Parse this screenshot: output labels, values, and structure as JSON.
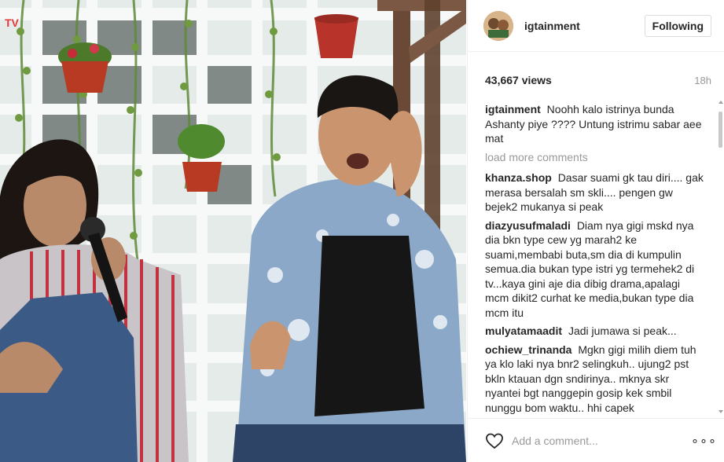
{
  "post": {
    "username": "igtainment",
    "follow_label": "Following",
    "views": "43,667 views",
    "time": "18h"
  },
  "caption": {
    "user": "igtainment",
    "text": "Noohh kalo istrinya bunda Ashanty piye ???? Untung istrimu sabar aee mat"
  },
  "load_more": "load more comments",
  "comments": [
    {
      "user": "khanza.shop",
      "text": "Dasar suami gk tau diri.... gak merasa bersalah sm skli.... pengen gw bejek2 mukanya si peak"
    },
    {
      "user": "diazyusufmaladi",
      "text": "Diam nya gigi mskd nya dia bkn type cew yg marah2 ke suami,membabi buta,sm dia di kumpulin semua.dia bukan type istri yg termehek2 di tv...kaya gini aje dia dibig drama,apalagi mcm dikit2 curhat ke media,bukan type dia mcm itu"
    },
    {
      "user": "mulyatamaadit",
      "text": "Jadi jumawa si peak..."
    },
    {
      "user": "ochiew_trinanda",
      "text": "Mgkn gigi milih diem tuh ya klo laki nya bnr2 selingkuh.. ujung2 pst bkln ktauan dgn sndirinya.. mknya skr nyantei bgt nanggepin gosip kek smbil nunggu bom waktu.. hhi capek"
    }
  ],
  "footer": {
    "comment_placeholder": "Add a comment...",
    "more_label": "∘∘∘"
  },
  "icons": {
    "like": "heart-icon",
    "more": "more-options-icon"
  },
  "colors": {
    "text": "#262626",
    "muted": "#999999",
    "border": "#efefef"
  }
}
